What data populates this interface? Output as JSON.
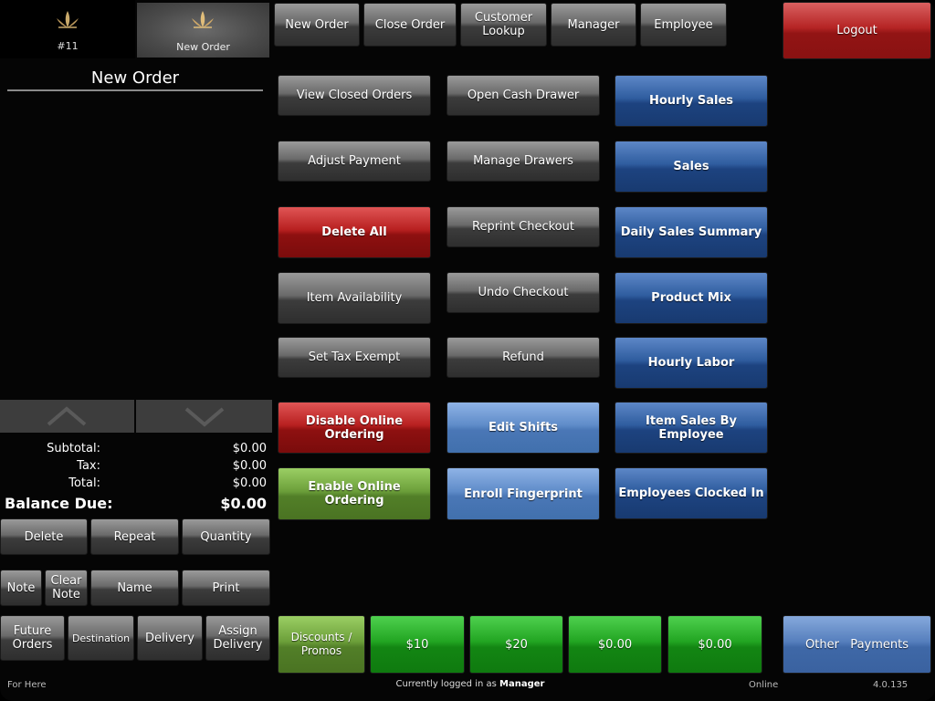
{
  "tabs": {
    "order_tab": {
      "label": "#11"
    },
    "new_order_tab": {
      "label": "New Order"
    }
  },
  "header": {
    "buttons": [
      "New Order",
      "Close Order",
      "Customer Lookup",
      "Manager",
      "Employee"
    ],
    "logout": "Logout"
  },
  "order_panel": {
    "title": "New Order",
    "subtotal_label": "Subtotal:",
    "subtotal": "$0.00",
    "tax_label": "Tax:",
    "tax": "$0.00",
    "total_label": "Total:",
    "total": "$0.00",
    "balance_label": "Balance Due:",
    "balance": "$0.00"
  },
  "left_buttons": {
    "row1": [
      "Delete",
      "Repeat",
      "Quantity"
    ],
    "row2": [
      "Note",
      "Clear Note",
      "Name",
      "Print"
    ],
    "row3": [
      "Future Orders",
      "Destination",
      "Delivery",
      "Assign Delivery"
    ]
  },
  "manager_functions": {
    "col1": [
      "View Closed Orders",
      "Adjust Payment",
      "Delete All",
      "Item Availability",
      "Set Tax Exempt",
      "Disable Online Ordering",
      "Enable Online Ordering"
    ],
    "col2": [
      "Open Cash Drawer",
      "Manage Drawers",
      "Reprint Checkout",
      "Undo Checkout",
      "Refund",
      "Edit Shifts",
      "Enroll Fingerprint"
    ],
    "col3": [
      "Hourly Sales",
      "Sales",
      "Daily Sales Summary",
      "Product Mix",
      "Hourly Labor",
      "Item Sales By Employee",
      "Employees Clocked In"
    ]
  },
  "payment_bar": {
    "discounts": "Discounts / Promos",
    "amounts": [
      "$10",
      "$20",
      "$0.00",
      "$0.00"
    ],
    "other_payments": "Other   Payments"
  },
  "status_bar": {
    "order_type": "For Here",
    "logged_in_prefix": "Currently logged in as",
    "user": "Manager",
    "connection": "Online",
    "version": "4.0.135"
  }
}
